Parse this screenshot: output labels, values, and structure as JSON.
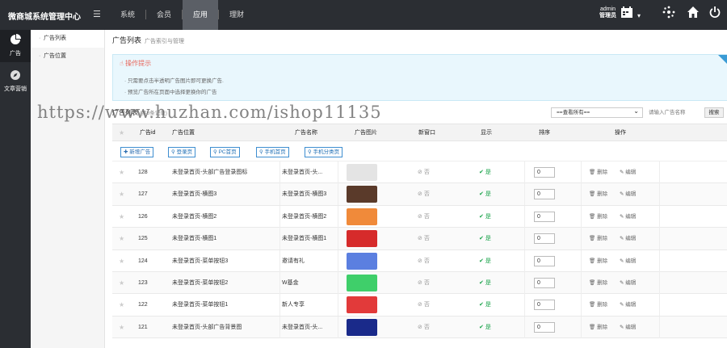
{
  "topbar": {
    "title": "微商城系统管理中心",
    "nav": [
      "系统",
      "会员",
      "应用",
      "理财"
    ],
    "active_nav": "应用",
    "admin_name": "admin",
    "admin_role": "管理员"
  },
  "sidebar": {
    "items": [
      {
        "label": "广告",
        "icon": "pie-chart-icon"
      },
      {
        "label": "文章营销",
        "icon": "compass-icon"
      }
    ]
  },
  "subnav": {
    "items": [
      "广告列表",
      "广告位置"
    ]
  },
  "page": {
    "title": "广告列表",
    "subtitle": "广告索引与管理"
  },
  "tips": {
    "title": "操作提示",
    "lines": [
      "只需要点击半透明广告图片即可更换广告.",
      "预览广告所在页面中选择更换你的广告"
    ]
  },
  "watermark": "https://www.huzhan.com/ishop11135",
  "list": {
    "title": "广告列表",
    "count_text": "(共8条记录)",
    "filter_value": "==查看所有==",
    "search_placeholder": "请输入广告名称",
    "search_button": "搜索"
  },
  "columns": [
    "广告id",
    "广告位置",
    "广告名称",
    "广告图片",
    "新窗口",
    "显示",
    "排序",
    "操作"
  ],
  "toolbar": {
    "add": "新增广告",
    "filters": [
      "登录页",
      "PC首页",
      "手机首页",
      "手机分类页"
    ]
  },
  "rows": [
    {
      "id": "128",
      "position": "未登录首页-头部广告登录图标",
      "name": "未登录首页-头...",
      "new_window": "否",
      "show": "是",
      "sort": "0",
      "thumb_color": "#e4e4e4",
      "thumb_text": ""
    },
    {
      "id": "127",
      "position": "未登录首页-横图3",
      "name": "未登录首页-横图3",
      "new_window": "否",
      "show": "是",
      "sort": "0",
      "thumb_color": "#5a3a2a",
      "thumb_text": ""
    },
    {
      "id": "126",
      "position": "未登录首页-横图2",
      "name": "未登录首页-横图2",
      "new_window": "否",
      "show": "是",
      "sort": "0",
      "thumb_color": "#f08a3a",
      "thumb_text": ""
    },
    {
      "id": "125",
      "position": "未登录首页-横图1",
      "name": "未登录首页-横图1",
      "new_window": "否",
      "show": "是",
      "sort": "0",
      "thumb_color": "#d62b2b",
      "thumb_text": ""
    },
    {
      "id": "124",
      "position": "未登录首页-菜单按钮3",
      "name": "邀请有礼",
      "new_window": "否",
      "show": "是",
      "sort": "0",
      "thumb_color": "#5b7fe0",
      "thumb_text": ""
    },
    {
      "id": "123",
      "position": "未登录首页-菜单按钮2",
      "name": "W基金",
      "new_window": "否",
      "show": "是",
      "sort": "0",
      "thumb_color": "#3fcf6a",
      "thumb_text": ""
    },
    {
      "id": "122",
      "position": "未登录首页-菜单按钮1",
      "name": "新人专享",
      "new_window": "否",
      "show": "是",
      "sort": "0",
      "thumb_color": "#e23a3a",
      "thumb_text": ""
    },
    {
      "id": "121",
      "position": "未登录首页-头部广告背景图",
      "name": "未登录首页-头...",
      "new_window": "否",
      "show": "是",
      "sort": "0",
      "thumb_color": "#1a2a8a",
      "thumb_text": "中"
    }
  ],
  "actions": {
    "delete": "删除",
    "edit": "编辑"
  }
}
